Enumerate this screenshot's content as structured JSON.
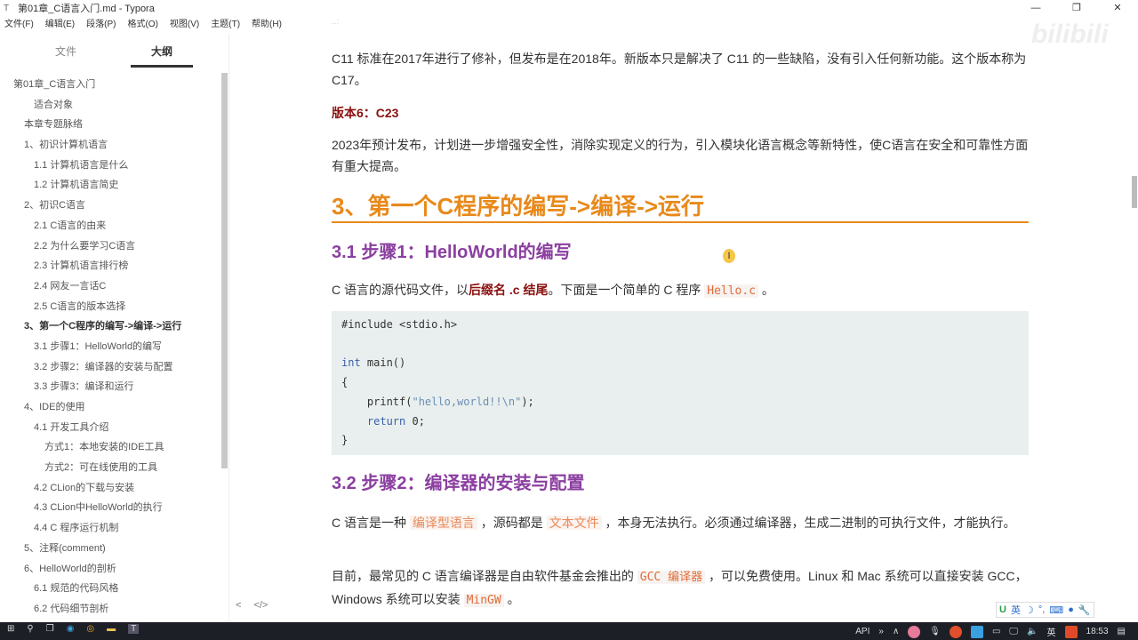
{
  "window": {
    "title": "第01章_C语言入门.md - Typora",
    "app_icon": "T",
    "min": "—",
    "max": "❐",
    "close": "✕"
  },
  "menu": [
    "文件(F)",
    "编辑(E)",
    "段落(P)",
    "格式(O)",
    "视图(V)",
    "主题(T)",
    "帮助(H)"
  ],
  "sidebar": {
    "tabs": [
      "文件",
      "大纲"
    ],
    "active_tab": "大纲",
    "outline": [
      {
        "label": "第01章_C语言入门",
        "level": 1
      },
      {
        "label": "适合对象",
        "level": 3
      },
      {
        "label": "本章专题脉络",
        "level": 2
      },
      {
        "label": "1、初识计算机语言",
        "level": 2
      },
      {
        "label": "1.1 计算机语言是什么",
        "level": 3
      },
      {
        "label": "1.2 计算机语言简史",
        "level": 3
      },
      {
        "label": "2、初识C语言",
        "level": 2
      },
      {
        "label": "2.1 C语言的由来",
        "level": 3
      },
      {
        "label": "2.2 为什么要学习C语言",
        "level": 3
      },
      {
        "label": "2.3 计算机语言排行榜",
        "level": 3
      },
      {
        "label": "2.4 网友一言话C",
        "level": 3
      },
      {
        "label": "2.5 C语言的版本选择",
        "level": 3
      },
      {
        "label": "3、第一个C程序的编写->编译->运行",
        "level": 2,
        "active": true
      },
      {
        "label": "3.1 步骤1：HelloWorld的编写",
        "level": 3
      },
      {
        "label": "3.2 步骤2：编译器的安装与配置",
        "level": 3
      },
      {
        "label": "3.3 步骤3：编译和运行",
        "level": 3
      },
      {
        "label": "4、IDE的使用",
        "level": 2
      },
      {
        "label": "4.1 开发工具介绍",
        "level": 3
      },
      {
        "label": "方式1：本地安装的IDE工具",
        "level": 4
      },
      {
        "label": "方式2：可在线使用的工具",
        "level": 4
      },
      {
        "label": "4.2 CLion的下载与安装",
        "level": 3
      },
      {
        "label": "4.3 CLion中HelloWorld的执行",
        "level": 3
      },
      {
        "label": "4.4 C 程序运行机制",
        "level": 3
      },
      {
        "label": "5、注释(comment)",
        "level": 2
      },
      {
        "label": "6、HelloWorld的剖析",
        "level": 2
      },
      {
        "label": "6.1 规范的代码风格",
        "level": 3
      },
      {
        "label": "6.2 代码细节剖析",
        "level": 3
      }
    ],
    "footer": {
      "back": "<",
      "source": "</>"
    }
  },
  "content": {
    "p1": "C11 标准在2017年进行了修补，但发布是在2018年。新版本只是解决了 C11 的一些缺陷，没有引入任何新功能。这个版本称为 C17。",
    "v6": "版本6：C23",
    "p2": "2023年预计发布，计划进一步增强安全性，消除实现定义的行为，引入模块化语言概念等新特性，使C语言在安全和可靠性方面有重大提高。",
    "h2": "3、第一个C程序的编写->编译->运行",
    "h3a": "3.1 步骤1：HelloWorld的编写",
    "p3": {
      "a": "C 语言的源代码文件，以",
      "b": "后缀名 .c 结尾",
      "c": "。下面是一个简单的 C 程序 ",
      "code": "Hello.c",
      "d": " 。"
    },
    "code": {
      "l1": "#include <stdio.h>",
      "kw_int": "int",
      "main": " main()",
      "lb": "{",
      "printf": "    printf(",
      "str": "\"hello,world!!\\n\"",
      "end": ");",
      "ret_kw": "    return",
      "ret": " 0;",
      "rb": "}"
    },
    "h3b": "3.2 步骤2：编译器的安装与配置",
    "p4": {
      "a": "C 语言是一种 ",
      "m1": "编译型语言",
      "b": " ，源码都是 ",
      "m2": "文本文件",
      "c": " ，本身无法执行。必须通过编译器，生成二进制的可执行文件，才能执行。"
    },
    "p5": {
      "a": "目前，最常见的 C 语言编译器是自由软件基金会推出的 ",
      "m1": "GCC 编译器",
      "b": " ，可以免费使用。Linux 和 Mac 系统可以直接安装 GCC，Windows 系统可以安装 ",
      "m2": "MinGW",
      "c": " 。"
    }
  },
  "watermark": "bilibili",
  "ime": {
    "lang": "英",
    "icons": [
      "moon-icon",
      "punctuation-icon",
      "keyboard-icon",
      "user-icon",
      "wrench-icon"
    ]
  },
  "taskbar": {
    "api": "API",
    "chev": "»",
    "up": "∧",
    "lang": "英",
    "time": "18:53",
    "accent": "#1c1f26"
  }
}
